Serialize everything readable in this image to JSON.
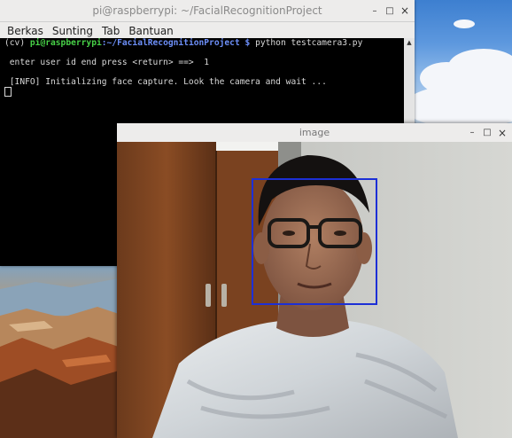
{
  "terminal": {
    "title": "pi@raspberrypi: ~/FacialRecognitionProject",
    "menu": [
      "Berkas",
      "Sunting",
      "Tab",
      "Bantuan"
    ],
    "prompt_env": "(cv)",
    "prompt_user": "pi@raspberrypi",
    "prompt_path": ":~/FacialRecognitionProject $",
    "command": "python testcamera3.py",
    "line_input": " enter user id end press <return> ==>  1",
    "line_info": " [INFO] Initializing face capture. Look the camera and wait ..."
  },
  "image_window": {
    "title": "image"
  },
  "window_controls": {
    "minimize": "–",
    "maximize": "□",
    "close": "×"
  },
  "colors": {
    "face_box": "#1c2fd6",
    "prompt_green": "#47d147",
    "prompt_blue": "#6d8ff8"
  }
}
